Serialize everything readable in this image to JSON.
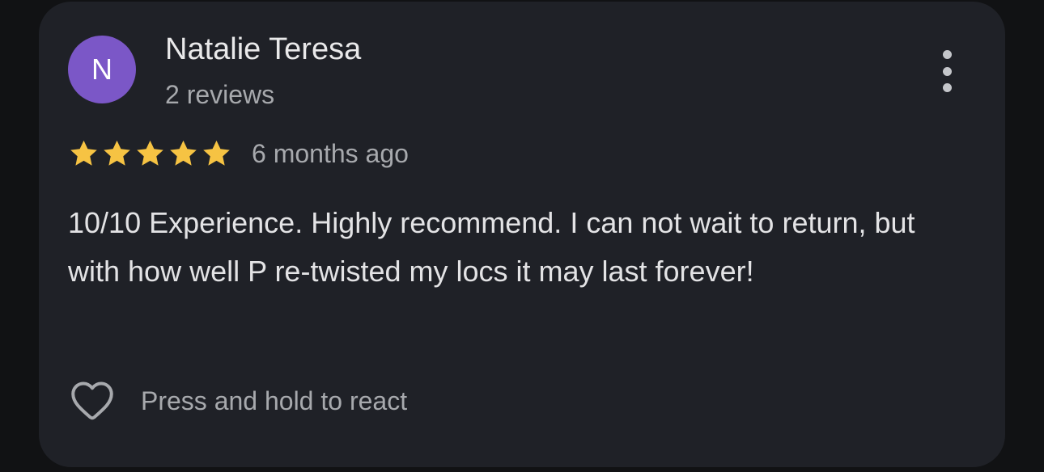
{
  "review": {
    "avatar_initial": "N",
    "author_name": "Natalie Teresa",
    "review_count": "2 reviews",
    "rating": 5,
    "rating_max": 5,
    "time_ago": "6 months ago",
    "text": "10/10 Experience. Highly recommend. I can not wait to return, but with how well P re-twisted my locs it may last forever!",
    "more_icon": "more-vert-icon",
    "star_icon": "star-icon",
    "react_icon": "heart-outline-icon",
    "react_label": "Press and hold to react"
  },
  "colors": {
    "background": "#111214",
    "card": "#1f2127",
    "avatar": "#7b57c7",
    "star": "#f6c343",
    "primary_text": "#e9e9ea",
    "secondary_text": "#a7a9ad"
  }
}
